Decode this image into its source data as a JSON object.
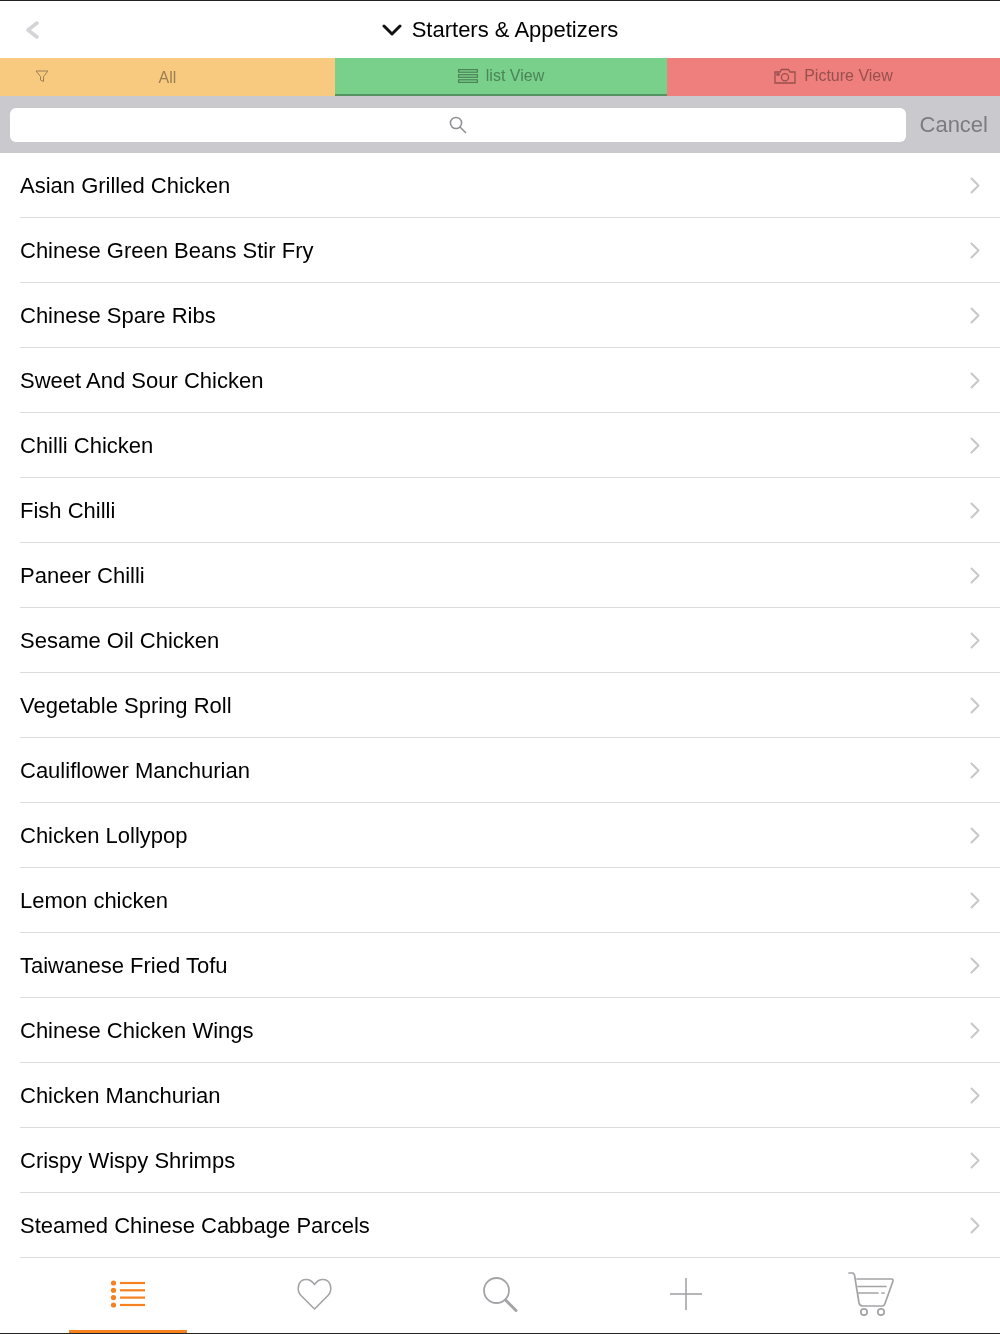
{
  "header": {
    "title": "Starters & Appetizers"
  },
  "segments": [
    {
      "kind": "filter",
      "label": "All",
      "color": "#f7ca80",
      "selected": false
    },
    {
      "kind": "list",
      "label": "list View",
      "color": "#78d08a",
      "selected": true
    },
    {
      "kind": "picture",
      "label": "Picture View",
      "color": "#ef7f7c",
      "selected": false
    }
  ],
  "search": {
    "cancel": "Cancel"
  },
  "items": [
    {
      "label": "Asian Grilled Chicken"
    },
    {
      "label": "Chinese Green Beans Stir Fry"
    },
    {
      "label": "Chinese Spare Ribs"
    },
    {
      "label": "Sweet And Sour Chicken"
    },
    {
      "label": "Chilli Chicken"
    },
    {
      "label": "Fish Chilli"
    },
    {
      "label": "Paneer Chilli"
    },
    {
      "label": "Sesame Oil Chicken"
    },
    {
      "label": "Vegetable Spring Roll"
    },
    {
      "label": "Cauliflower Manchurian"
    },
    {
      "label": "Chicken Lollypop"
    },
    {
      "label": "Lemon chicken"
    },
    {
      "label": "Taiwanese Fried Tofu"
    },
    {
      "label": "Chinese Chicken Wings"
    },
    {
      "label": "Chicken Manchurian"
    },
    {
      "label": "Crispy Wispy Shrimps"
    },
    {
      "label": "Steamed Chinese Cabbage Parcels"
    }
  ],
  "tab_bar": [
    {
      "kind": "list",
      "selected": true
    },
    {
      "kind": "favorites",
      "selected": false
    },
    {
      "kind": "search",
      "selected": false
    },
    {
      "kind": "add",
      "selected": false
    },
    {
      "kind": "cart",
      "selected": false
    }
  ]
}
